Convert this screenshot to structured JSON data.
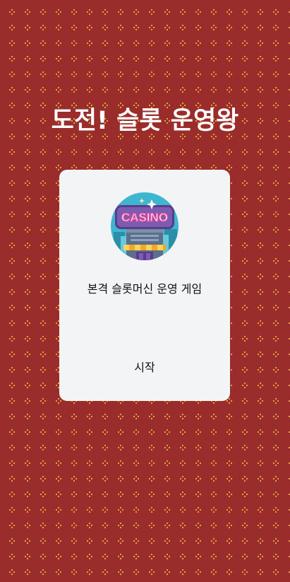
{
  "title": "도전! 슬롯 운영왕",
  "card": {
    "logo_text": "CASINO",
    "subtitle": "본격 슬롯머신 운영 게임",
    "start_label": "시작"
  },
  "colors": {
    "background": "#9b2c2c",
    "pattern": "#e0a93a",
    "card": "#f3f4f6",
    "logo_teal": "#3fb6d0",
    "logo_sign": "#5b3c8c",
    "logo_text": "#f14b9c"
  }
}
